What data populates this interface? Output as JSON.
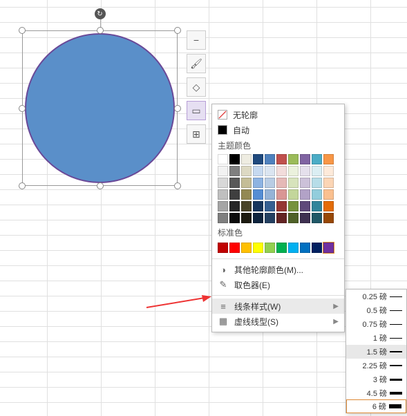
{
  "outline_menu": {
    "no_outline": "无轮廓",
    "auto": "自动",
    "theme_label": "主题颜色",
    "standard_label": "标准色",
    "more_colors": "其他轮廓颜色(M)...",
    "eyedropper": "取色器(E)",
    "line_style": "线条样式(W)",
    "dash_style": "虚线线型(S)"
  },
  "theme_rows": [
    [
      "#ffffff",
      "#000000",
      "#eeece1",
      "#1f497d",
      "#4f81bd",
      "#c0504d",
      "#9bbb59",
      "#8064a2",
      "#4bacc6",
      "#f79646"
    ],
    [
      "#f2f2f2",
      "#7f7f7f",
      "#ddd9c3",
      "#c6d9f0",
      "#dbe5f1",
      "#f2dcdb",
      "#ebf1dd",
      "#e5e0ec",
      "#dbeef3",
      "#fdeada"
    ],
    [
      "#d8d8d8",
      "#595959",
      "#c4bd97",
      "#8db3e2",
      "#b8cce4",
      "#e5b9b7",
      "#d7e3bc",
      "#ccc1d9",
      "#b7dde8",
      "#fbd5b5"
    ],
    [
      "#bfbfbf",
      "#3f3f3f",
      "#938953",
      "#548dd4",
      "#95b3d7",
      "#d99694",
      "#c3d69b",
      "#b2a2c7",
      "#92cddc",
      "#fac08f"
    ],
    [
      "#a5a5a5",
      "#262626",
      "#494429",
      "#17365d",
      "#366092",
      "#953734",
      "#76923c",
      "#5f497a",
      "#31859b",
      "#e36c09"
    ],
    [
      "#7f7f7f",
      "#0c0c0c",
      "#1d1b10",
      "#0f243e",
      "#244061",
      "#632423",
      "#4f6128",
      "#3f3151",
      "#205867",
      "#974806"
    ]
  ],
  "standard_colors": [
    "#c00000",
    "#ff0000",
    "#ffc000",
    "#ffff00",
    "#92d050",
    "#00b050",
    "#00b0f0",
    "#0070c0",
    "#002060",
    "#7030a0"
  ],
  "line_weights": [
    {
      "label": "0.25 磅",
      "w": 0.5,
      "sel": false
    },
    {
      "label": "0.5 磅",
      "w": 1,
      "sel": false
    },
    {
      "label": "0.75 磅",
      "w": 1,
      "sel": false
    },
    {
      "label": "1 磅",
      "w": 1.5,
      "sel": false
    },
    {
      "label": "1.5 磅",
      "w": 2,
      "sel": true
    },
    {
      "label": "2.25 磅",
      "w": 2.5,
      "sel": false
    },
    {
      "label": "3 磅",
      "w": 3,
      "sel": false
    },
    {
      "label": "4.5 磅",
      "w": 4.5,
      "sel": false
    },
    {
      "label": "6 磅",
      "w": 6,
      "sel": false,
      "hl": true
    }
  ]
}
